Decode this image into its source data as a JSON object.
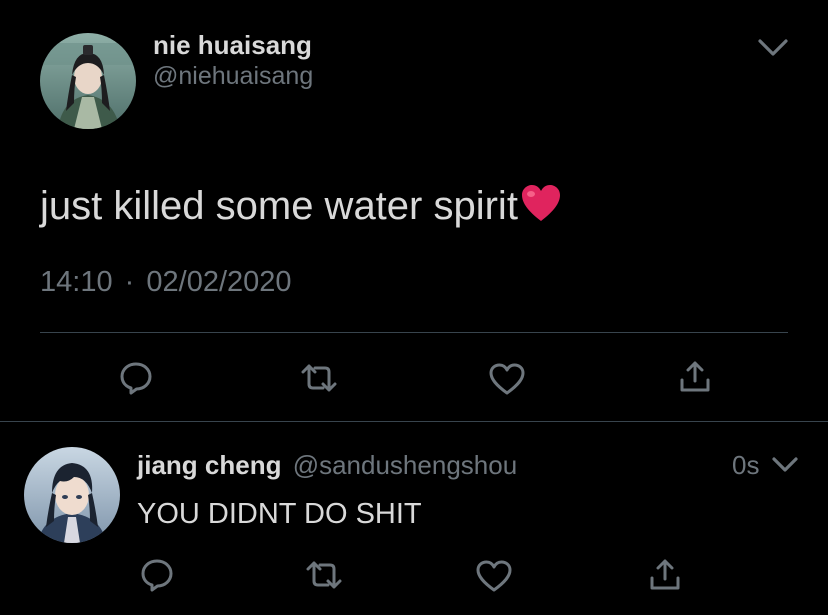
{
  "main_tweet": {
    "author_name": "nie huaisang",
    "author_handle": "@niehuaisang",
    "text": "just killed some water spirit",
    "emoji": "❤️",
    "time": "14:10",
    "separator": "·",
    "date": "02/02/2020"
  },
  "reply": {
    "author_name": "jiang cheng",
    "author_handle": "@sandushengshou",
    "timestamp": "0s",
    "text": "YOU DIDNT DO SHIT"
  },
  "colors": {
    "background": "#000000",
    "text": "#d9d9d9",
    "muted": "#6e767d",
    "divider": "#38444d",
    "heart": "#e0245e"
  },
  "icons": {
    "caret": "chevron-down-icon",
    "reply": "reply-icon",
    "retweet": "retweet-icon",
    "like": "heart-icon",
    "share": "share-icon"
  }
}
